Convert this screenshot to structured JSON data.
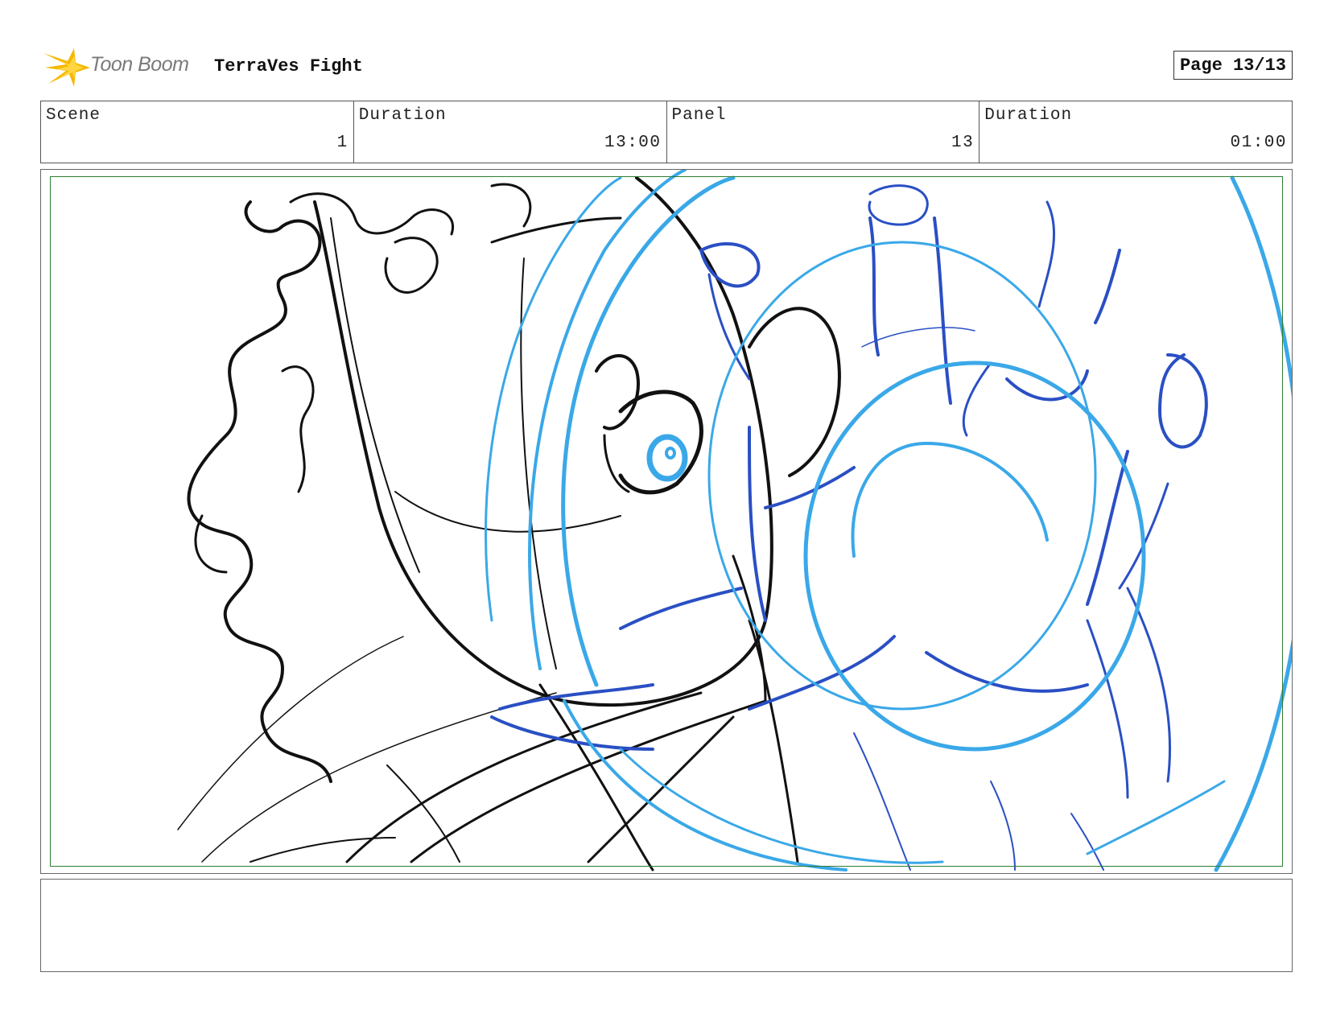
{
  "header": {
    "logo_text": "Toon Boom",
    "project_title": "TerraVes Fight",
    "page_label": "Page 13/13"
  },
  "info": {
    "scene_label": "Scene",
    "scene_value": "1",
    "scene_duration_label": "Duration",
    "scene_duration_value": "13:00",
    "panel_label": "Panel",
    "panel_value": "13",
    "panel_duration_label": "Duration",
    "panel_duration_value": "01:00"
  },
  "caption": {
    "text": ""
  },
  "colors": {
    "ink": "#111111",
    "light_blue": "#3aa8e8",
    "dark_blue": "#2a4fc4",
    "safe_frame": "#2e7d32",
    "logo_yellow": "#f5b800"
  },
  "icons": {
    "logo": "starburst-logo-icon"
  }
}
